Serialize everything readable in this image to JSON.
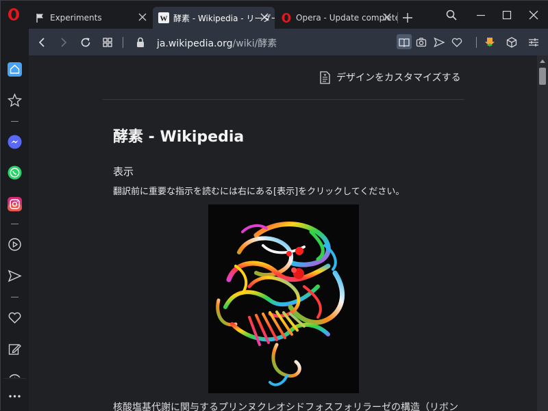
{
  "browser": {
    "tabs": [
      {
        "label": "Experiments",
        "icon": "flag-icon",
        "active": false
      },
      {
        "label": "酵素 - Wikipedia - リーダー",
        "icon": "wikipedia-icon",
        "active": true
      },
      {
        "label": "Opera - Update complete",
        "icon": "opera-icon",
        "active": false
      }
    ],
    "url": {
      "host": "ja.wikipedia.org",
      "path": "/wiki/酵素"
    },
    "sidebar_icons": [
      "home-icon",
      "star-icon",
      "messenger-icon",
      "whatsapp-icon",
      "instagram-icon",
      "player-icon",
      "send-icon",
      "heart-icon",
      "edit-icon",
      "clock-icon",
      "more-icon"
    ],
    "colors": {
      "accent": "#4aa3f0",
      "opera_red": "#e4171e"
    }
  },
  "reader": {
    "customize_label": "デザインをカスタマイズする",
    "title": "酵素 - Wikipedia",
    "subhead": "表示",
    "note": "翻訳前に重要な指示を読むには右にある[表示]をクリックしてください。",
    "caption": "核酸塩基代謝に関与するプリンヌクレオシドフォスフォリラーゼの構造（リボン"
  }
}
